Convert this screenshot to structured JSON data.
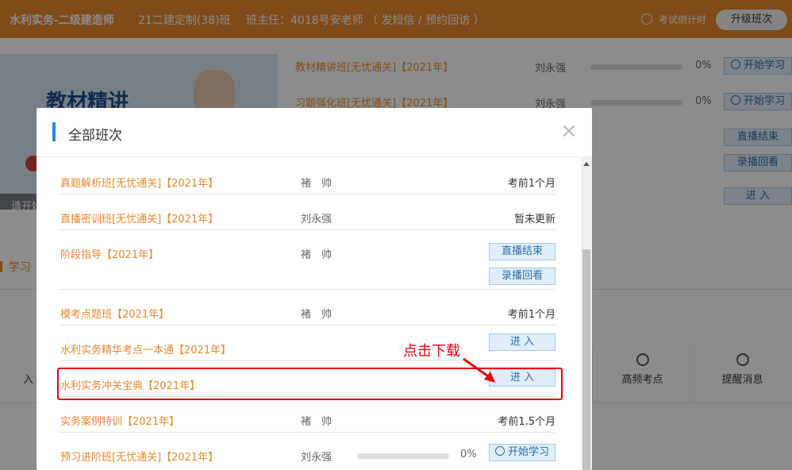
{
  "header": {
    "course": "水利实务-二级建造师",
    "class_name": "21二建定制(38)班",
    "teacher": "班主任：4018号安老师 （ 发短信 / 预约回访 ）",
    "countdown": "考试倒计时",
    "upgrade": "升级班次"
  },
  "background": {
    "banner_title": "教材精讲",
    "banner_caption": "请开始",
    "rows": [
      {
        "name": "教材精讲班[无忧通关]【2021年】",
        "teacher": "刘永强",
        "progress": "0%",
        "action": "开始学习"
      },
      {
        "name": "习题强化班[无忧通关]【2021年】",
        "teacher": "刘永强",
        "progress": "0%",
        "action": "开始学习"
      }
    ],
    "side_buttons": [
      "直播结束",
      "录播回看",
      "进 入"
    ],
    "section_label": "学习",
    "grid_items": [
      "高频考点",
      "提醒消息"
    ],
    "left_fragments": [
      "入"
    ]
  },
  "modal": {
    "title": "全部班次",
    "close": "×",
    "rows": [
      {
        "name": "真题解析班[无忧通关]【2021年】",
        "teacher": "褚　帅",
        "status": "考前1个月"
      },
      {
        "name": "直播密训班[无忧通关]【2021年】",
        "teacher": "刘永强",
        "status": "暂未更新"
      },
      {
        "name": "阶段指导【2021年】",
        "teacher": "褚　帅",
        "buttons": [
          "直播结束",
          "录播回看"
        ]
      },
      {
        "name": "模考点题班【2021年】",
        "teacher": "褚　帅",
        "status": "考前1个月"
      },
      {
        "name": "水利实务精华考点一本通【2021年】",
        "teacher": "",
        "buttons": [
          "进 入"
        ]
      },
      {
        "name": "水利实务冲关宝典【2021年】",
        "teacher": "",
        "buttons": [
          "进 入"
        ]
      },
      {
        "name": "实务案例特训【2021年】",
        "teacher": "褚　帅",
        "status": "考前1.5个月"
      },
      {
        "name": "预习进阶班[无忧通关]【2021年】",
        "teacher": "刘永强",
        "progress": "0%",
        "buttons": [
          "开始学习"
        ]
      }
    ]
  },
  "annotation": {
    "text": "点击下载"
  },
  "colors": {
    "brand_orange": "#e8892e",
    "accent_blue": "#1e8be6",
    "highlight_red": "#e60012"
  }
}
